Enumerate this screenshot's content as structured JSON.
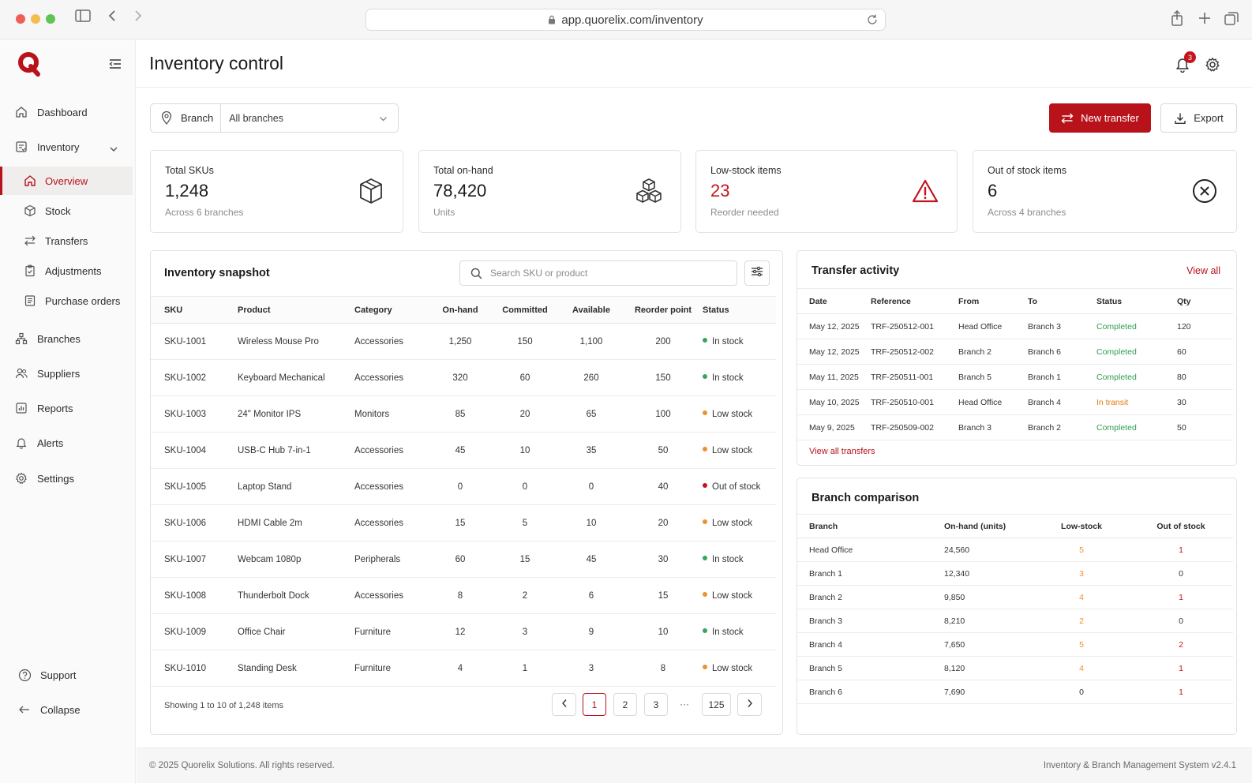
{
  "browser": {
    "url": "app.quorelix.com/inventory"
  },
  "app": {
    "logo_letter": "Q",
    "brand_color": "#b8121b"
  },
  "header": {
    "title": "Inventory control",
    "notification_count": "3"
  },
  "sidebar": {
    "items": [
      {
        "label": "Dashboard",
        "icon": "home-icon"
      },
      {
        "label": "Inventory",
        "icon": "inventory-icon"
      },
      {
        "label": "Branches",
        "icon": "branches-icon"
      },
      {
        "label": "Suppliers",
        "icon": "users-icon"
      },
      {
        "label": "Reports",
        "icon": "reports-icon"
      },
      {
        "label": "Alerts",
        "icon": "bell-icon"
      },
      {
        "label": "Settings",
        "icon": "gear-icon"
      }
    ],
    "inventory_sub": [
      {
        "label": "Overview",
        "icon": "home-icon"
      },
      {
        "label": "Stock",
        "icon": "box-icon"
      },
      {
        "label": "Transfers",
        "icon": "transfer-icon"
      },
      {
        "label": "Adjustments",
        "icon": "clipboard-icon"
      },
      {
        "label": "Purchase orders",
        "icon": "purchase-icon"
      }
    ],
    "support": "Support",
    "collapse": "Collapse"
  },
  "filter": {
    "branch_label": "Branch",
    "branch_value": "All branches"
  },
  "actions": {
    "new_transfer": "New transfer",
    "export": "Export"
  },
  "kpis": [
    {
      "label": "Total SKUs",
      "value": "1,248",
      "sub": "Across 6 branches",
      "icon": "box-icon"
    },
    {
      "label": "Total on-hand",
      "value": "78,420",
      "sub": "Units",
      "icon": "boxes-icon"
    },
    {
      "label": "Low-stock items",
      "value": "23",
      "sub": "Reorder needed",
      "icon": "warning-icon"
    },
    {
      "label": "Out of stock items",
      "value": "6",
      "sub": "Across 4 branches",
      "icon": "x-circle-icon"
    }
  ],
  "snapshot": {
    "title": "Inventory snapshot",
    "search_placeholder": "Search SKU or product",
    "columns": [
      "SKU",
      "Product",
      "Category",
      "On-hand",
      "Committed",
      "Available",
      "Reorder point",
      "Status"
    ],
    "rows": [
      [
        "SKU-1001",
        "Wireless Mouse Pro",
        "Accessories",
        "1,250",
        "150",
        "1,100",
        "200",
        "In stock"
      ],
      [
        "SKU-1002",
        "Keyboard Mechanical",
        "Accessories",
        "320",
        "60",
        "260",
        "150",
        "In stock"
      ],
      [
        "SKU-1003",
        "24\" Monitor IPS",
        "Monitors",
        "85",
        "20",
        "65",
        "100",
        "Low stock"
      ],
      [
        "SKU-1004",
        "USB-C Hub 7-in-1",
        "Accessories",
        "45",
        "10",
        "35",
        "50",
        "Low stock"
      ],
      [
        "SKU-1005",
        "Laptop Stand",
        "Accessories",
        "0",
        "0",
        "0",
        "40",
        "Out of stock"
      ],
      [
        "SKU-1006",
        "HDMI Cable 2m",
        "Accessories",
        "15",
        "5",
        "10",
        "20",
        "Low stock"
      ],
      [
        "SKU-1007",
        "Webcam 1080p",
        "Peripherals",
        "60",
        "15",
        "45",
        "30",
        "In stock"
      ],
      [
        "SKU-1008",
        "Thunderbolt Dock",
        "Accessories",
        "8",
        "2",
        "6",
        "15",
        "Low stock"
      ],
      [
        "SKU-1009",
        "Office Chair",
        "Furniture",
        "12",
        "3",
        "9",
        "10",
        "In stock"
      ],
      [
        "SKU-1010",
        "Standing Desk",
        "Furniture",
        "4",
        "1",
        "3",
        "8",
        "Low stock"
      ]
    ],
    "showing": "Showing 1 to 10 of 1,248 items",
    "pages": [
      "1",
      "2",
      "3",
      "125"
    ],
    "ellipsis": "···"
  },
  "status_colors": {
    "In stock": "#3aa55a",
    "Low stock": "#e8932f",
    "Out of stock": "#c4141c",
    "Completed": "#2f9e4e",
    "In transit": "#e07b12"
  },
  "transfers": {
    "title": "Transfer activity",
    "view_all": "View all",
    "columns": [
      "Date",
      "Reference",
      "From",
      "To",
      "Status",
      "Qty"
    ],
    "rows": [
      [
        "May 12, 2025",
        "TRF-250512-001",
        "Head Office",
        "Branch 3",
        "Completed",
        "120"
      ],
      [
        "May 12, 2025",
        "TRF-250512-002",
        "Branch 2",
        "Branch 6",
        "Completed",
        "60"
      ],
      [
        "May 11, 2025",
        "TRF-250511-001",
        "Branch 5",
        "Branch 1",
        "Completed",
        "80"
      ],
      [
        "May 10, 2025",
        "TRF-250510-001",
        "Head Office",
        "Branch 4",
        "In transit",
        "30"
      ],
      [
        "May 9, 2025",
        "TRF-250509-002",
        "Branch 3",
        "Branch 2",
        "Completed",
        "50"
      ]
    ],
    "view_all_transfers": "View all transfers"
  },
  "branch_comparison": {
    "title": "Branch comparison",
    "columns": [
      "Branch",
      "On-hand (units)",
      "Low-stock",
      "Out of stock"
    ],
    "rows": [
      [
        "Head Office",
        "24,560",
        "5",
        "1"
      ],
      [
        "Branch 1",
        "12,340",
        "3",
        "0"
      ],
      [
        "Branch 2",
        "9,850",
        "4",
        "1"
      ],
      [
        "Branch 3",
        "8,210",
        "2",
        "0"
      ],
      [
        "Branch 4",
        "7,650",
        "5",
        "2"
      ],
      [
        "Branch 5",
        "8,120",
        "4",
        "1"
      ],
      [
        "Branch 6",
        "7,690",
        "0",
        "1"
      ]
    ]
  },
  "footer": {
    "copyright": "© 2025 Quorelix Solutions. All rights reserved.",
    "version": "Inventory & Branch Management System v2.4.1"
  }
}
